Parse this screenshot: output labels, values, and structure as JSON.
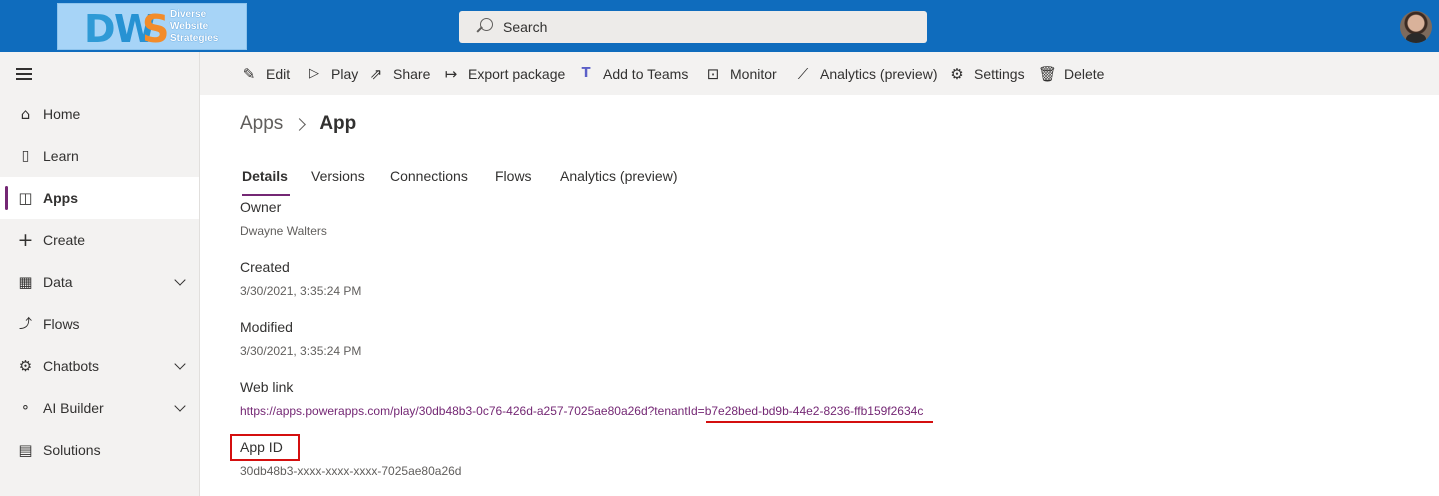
{
  "header": {
    "logo": {
      "mark": "DWS",
      "lines": [
        "Diverse",
        "Website",
        "Strategies"
      ]
    },
    "search": {
      "placeholder": "Search"
    }
  },
  "sidebar": {
    "items": [
      {
        "label": "Home",
        "icon": "home-icon",
        "expandable": false,
        "active": false
      },
      {
        "label": "Learn",
        "icon": "book-icon",
        "expandable": false,
        "active": false
      },
      {
        "label": "Apps",
        "icon": "apps-icon",
        "expandable": false,
        "active": true
      },
      {
        "label": "Create",
        "icon": "plus-icon",
        "expandable": false,
        "active": false
      },
      {
        "label": "Data",
        "icon": "table-icon",
        "expandable": true,
        "active": false
      },
      {
        "label": "Flows",
        "icon": "flow-icon",
        "expandable": false,
        "active": false
      },
      {
        "label": "Chatbots",
        "icon": "bot-icon",
        "expandable": true,
        "active": false
      },
      {
        "label": "AI Builder",
        "icon": "ai-builder-icon",
        "expandable": true,
        "active": false
      },
      {
        "label": "Solutions",
        "icon": "solutions-icon",
        "expandable": false,
        "active": false
      }
    ]
  },
  "toolbar": {
    "commands": [
      {
        "label": "Edit",
        "icon": "pencil-icon"
      },
      {
        "label": "Play",
        "icon": "play-icon"
      },
      {
        "label": "Share",
        "icon": "share-icon"
      },
      {
        "label": "Export package",
        "icon": "export-icon"
      },
      {
        "label": "Add to Teams",
        "icon": "teams-icon"
      },
      {
        "label": "Monitor",
        "icon": "monitor-icon"
      },
      {
        "label": "Analytics (preview)",
        "icon": "analytics-icon"
      },
      {
        "label": "Settings",
        "icon": "gear-icon"
      },
      {
        "label": "Delete",
        "icon": "trash-icon"
      }
    ]
  },
  "breadcrumb": {
    "root": "Apps",
    "current": "App"
  },
  "tabs": [
    {
      "label": "Details",
      "active": true
    },
    {
      "label": "Versions",
      "active": false
    },
    {
      "label": "Connections",
      "active": false
    },
    {
      "label": "Flows",
      "active": false
    },
    {
      "label": "Analytics (preview)",
      "active": false
    }
  ],
  "details": {
    "owner": {
      "label": "Owner",
      "value": "Dwayne Walters"
    },
    "created": {
      "label": "Created",
      "value": "3/30/2021, 3:35:24 PM"
    },
    "modified": {
      "label": "Modified",
      "value": "3/30/2021, 3:35:24 PM"
    },
    "web_link": {
      "label": "Web link",
      "value": "https://apps.powerapps.com/play/30db48b3-0c76-426d-a257-7025ae80a26d?tenantId=b7e28bed-bd9b-44e2-8236-ffb159f2634c"
    },
    "app_id": {
      "label": "App ID",
      "value": "30db48b3-xxxx-xxxx-xxxx-7025ae80a26d"
    }
  },
  "colors": {
    "header_bg": "#0f6cbd",
    "accent": "#742774",
    "annotation_red": "#d40f0f",
    "nav_bg": "#f3f2f1"
  }
}
